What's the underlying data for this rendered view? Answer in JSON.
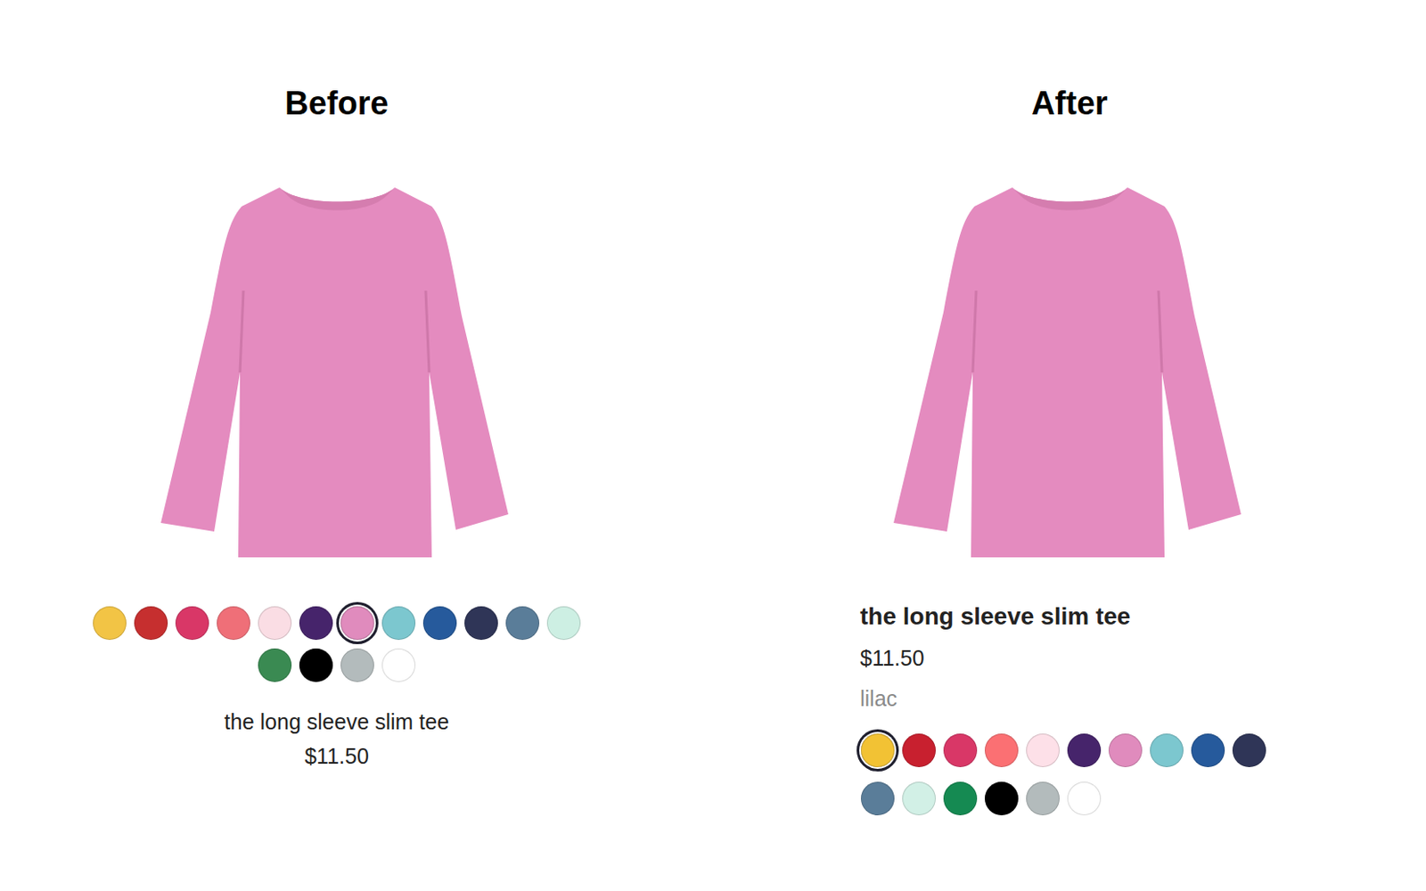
{
  "panels": [
    {
      "heading": "Before",
      "title": "the long sleeve slim tee",
      "price": "$11.50",
      "swatches": [
        {
          "color": "#f2c445",
          "selected": false
        },
        {
          "color": "#c62f2f",
          "selected": false
        },
        {
          "color": "#d93767",
          "selected": false
        },
        {
          "color": "#ef6f78",
          "selected": false
        },
        {
          "color": "#fadde4",
          "selected": false
        },
        {
          "color": "#46246b",
          "selected": false
        },
        {
          "color": "#e08bbd",
          "selected": true
        },
        {
          "color": "#7cc7cf",
          "selected": false
        },
        {
          "color": "#265a9c",
          "selected": false
        },
        {
          "color": "#2f3557",
          "selected": false
        },
        {
          "color": "#5a7d99",
          "selected": false
        },
        {
          "color": "#cdefe3",
          "selected": false
        },
        {
          "color": "#3a8a52",
          "selected": false
        },
        {
          "color": "#000000",
          "selected": false
        },
        {
          "color": "#b3bbbc",
          "selected": false
        },
        {
          "color": "#ffffff",
          "selected": false
        }
      ]
    },
    {
      "heading": "After",
      "title": "the long sleeve slim tee",
      "price": "$11.50",
      "color_name": "lilac",
      "swatches": [
        {
          "color": "#f2c234",
          "selected": true
        },
        {
          "color": "#c8202f",
          "selected": false
        },
        {
          "color": "#d93767",
          "selected": false
        },
        {
          "color": "#fb7073",
          "selected": false
        },
        {
          "color": "#fde0e8",
          "selected": false
        },
        {
          "color": "#46246b",
          "selected": false
        },
        {
          "color": "#e08bbd",
          "selected": false
        },
        {
          "color": "#7cc7cf",
          "selected": false
        },
        {
          "color": "#265a9c",
          "selected": false
        },
        {
          "color": "#2f3557",
          "selected": false
        },
        {
          "color": "#5a7d99",
          "selected": false
        },
        {
          "color": "#d2f0e6",
          "selected": false
        },
        {
          "color": "#158a52",
          "selected": false
        },
        {
          "color": "#000000",
          "selected": false
        },
        {
          "color": "#b3bbbc",
          "selected": false
        },
        {
          "color": "#ffffff",
          "selected": false
        }
      ]
    }
  ]
}
